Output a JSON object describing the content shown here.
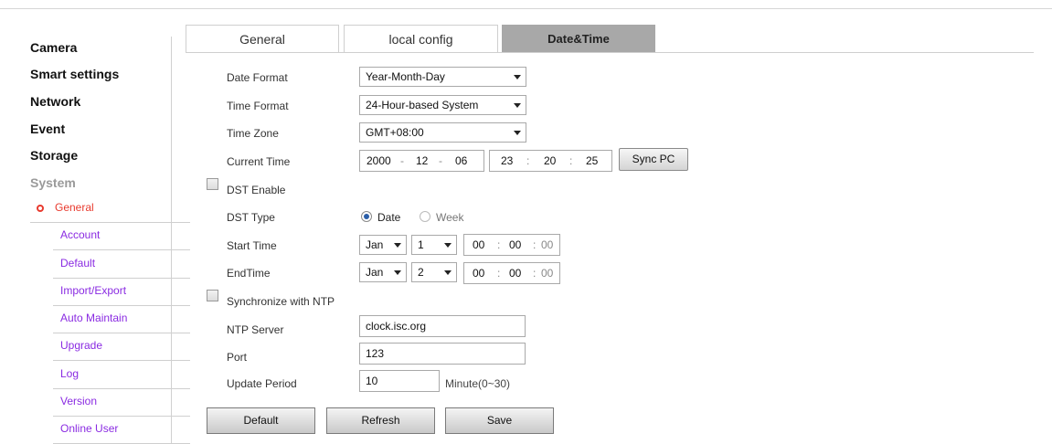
{
  "sidebar": {
    "main_items": [
      {
        "label": "Camera"
      },
      {
        "label": "Smart settings"
      },
      {
        "label": "Network"
      },
      {
        "label": "Event"
      },
      {
        "label": "Storage"
      },
      {
        "label": "System"
      }
    ],
    "sub_items": [
      {
        "label": "General",
        "active": true
      },
      {
        "label": "Account"
      },
      {
        "label": "Default"
      },
      {
        "label": "Import/Export"
      },
      {
        "label": "Auto Maintain"
      },
      {
        "label": "Upgrade"
      },
      {
        "label": "Log"
      },
      {
        "label": "Version"
      },
      {
        "label": "Online User"
      }
    ]
  },
  "tabs": [
    {
      "label": "General"
    },
    {
      "label": "local config"
    },
    {
      "label": "Date&Time",
      "active": true
    }
  ],
  "form": {
    "date_format": {
      "label": "Date Format",
      "value": "Year-Month-Day"
    },
    "time_format": {
      "label": "Time Format",
      "value": "24-Hour-based System"
    },
    "time_zone": {
      "label": "Time Zone",
      "value": "GMT+08:00"
    },
    "current_time": {
      "label": "Current Time",
      "year": "2000",
      "month": "12",
      "day": "06",
      "hour": "23",
      "minute": "20",
      "second": "25",
      "date_sep": "-",
      "time_sep": ":",
      "sync_label": "Sync PC"
    },
    "dst_enable": {
      "label": "DST Enable",
      "checked": false
    },
    "dst_type": {
      "label": "DST Type",
      "option_date": "Date",
      "option_week": "Week",
      "selected": "Date"
    },
    "start_time": {
      "label": "Start Time",
      "month": "Jan",
      "day": "1",
      "hour": "00",
      "minute": "00",
      "second": "00",
      "sep": ":"
    },
    "end_time": {
      "label": "EndTime",
      "month": "Jan",
      "day": "2",
      "hour": "00",
      "minute": "00",
      "second": "00",
      "sep": ":"
    },
    "ntp_sync": {
      "label": "Synchronize with NTP",
      "checked": false
    },
    "ntp_server": {
      "label": "NTP Server",
      "value": "clock.isc.org"
    },
    "port": {
      "label": "Port",
      "value": "123"
    },
    "update_period": {
      "label": "Update Period",
      "value": "10",
      "unit": "Minute(0~30)"
    }
  },
  "buttons": {
    "default": "Default",
    "refresh": "Refresh",
    "save": "Save"
  },
  "colors": {
    "active_sub": "#e83a2e",
    "sub_link": "#8a2be2",
    "active_tab": "#a8a8a8",
    "radio_on": "#2b5ea8"
  }
}
